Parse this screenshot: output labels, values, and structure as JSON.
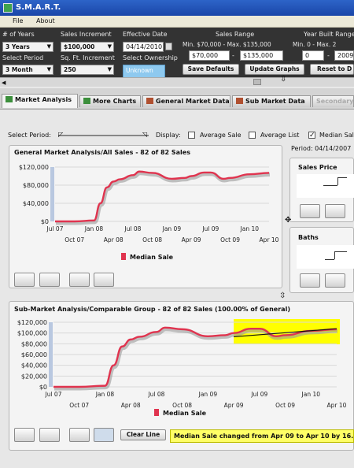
{
  "window": {
    "title": "S.M.A.R.T."
  },
  "menu": [
    "File",
    "About"
  ],
  "controls": {
    "years_label": "# of Years",
    "years_value": "3 Years",
    "period_label": "Select Period",
    "period_value": "3 Month",
    "sales_increment_label": "Sales Increment",
    "sales_increment_value": "$100,000",
    "sqft_increment_label": "Sq. Ft. Increment",
    "sqft_increment_value": "250",
    "effective_date_label": "Effective Date",
    "effective_date_value": "04/14/2010",
    "ownership_label": "Select Ownership",
    "ownership_value": "Unknown",
    "sales_range_label": "Sales Range",
    "sales_range_sub": "Min. $70,000 - Max. $135,000",
    "sales_min": "$70,000",
    "sales_max": "$135,000",
    "year_built_label": "Year Built Range",
    "year_built_sub": "Min. 0 - Max. 2",
    "year_min": "0",
    "year_max": "2009",
    "save_defaults": "Save Defaults",
    "update_graphs": "Update Graphs",
    "reset": "Reset to D"
  },
  "tabs": [
    "Market Analysis",
    "More Charts",
    "General Market Data",
    "Sub Market Data",
    "Secondary"
  ],
  "filters": {
    "select_period_label": "Select Period:",
    "display_label": "Display:",
    "average_sale": "Average Sale",
    "average_list": "Average List",
    "median_sale": "Median Sal"
  },
  "period_label": "Period: 04/14/2007",
  "side_panels": [
    {
      "title": "Sales Price"
    },
    {
      "title": "Baths"
    }
  ],
  "chart_panels": [
    {
      "title": "General Market Analysis/All Sales - 82 of 82 Sales"
    },
    {
      "title": "Sub-Market Analysis/Comparable Group - 82 of 82 Sales (100.00% of General)"
    }
  ],
  "clear_line": "Clear Line",
  "status_message": "Median Sale changed from Apr 09 to Apr 10 by 16.17%",
  "colors": {
    "series": "#e0344f",
    "highlight": "#ffff00",
    "band": "#333333"
  },
  "chart_data": [
    {
      "type": "line",
      "title": "General Market Analysis/All Sales - 82 of 82 Sales",
      "ylim": [
        0,
        120000
      ],
      "yticks": [
        "$120,000",
        "$80,000",
        "$40,000",
        "$0"
      ],
      "xticks_upper": [
        "Jul 07",
        "Jan 08",
        "Jul 08",
        "Jan 09",
        "Jul 09",
        "Jan 10"
      ],
      "xticks_lower": [
        "Oct 07",
        "Apr 08",
        "Oct 08",
        "Apr 09",
        "Oct 09",
        "Apr 10"
      ],
      "series": [
        {
          "name": "Median Sale",
          "x": [
            "Jul 07",
            "Oct 07",
            "Jan 08",
            "Feb 08",
            "Mar 08",
            "Apr 08",
            "May 08",
            "Jul 08",
            "Aug 08",
            "Oct 08",
            "Jan 09",
            "Mar 09",
            "Apr 09",
            "Jun 09",
            "Jul 09",
            "Sep 09",
            "Oct 09",
            "Jan 10",
            "Apr 10"
          ],
          "values": [
            0,
            0,
            2000,
            40000,
            75000,
            88000,
            93000,
            102000,
            110000,
            107000,
            94000,
            96000,
            100000,
            108000,
            108000,
            94000,
            96000,
            104000,
            107000
          ]
        }
      ]
    },
    {
      "type": "line",
      "title": "Sub-Market Analysis/Comparable Group - 82 of 82 Sales (100.00% of General)",
      "ylim": [
        0,
        120000
      ],
      "yticks": [
        "$120,000",
        "$100,000",
        "$80,000",
        "$60,000",
        "$40,000",
        "$20,000",
        "$0"
      ],
      "xticks_upper": [
        "Jul 07",
        "Jan 08",
        "Jul 08",
        "Jan 09",
        "Jul 09",
        "Jan 10"
      ],
      "xticks_lower": [
        "Oct 07",
        "Apr 08",
        "Oct 08",
        "Apr 09",
        "Oct 09",
        "Apr 10"
      ],
      "series": [
        {
          "name": "Median Sale",
          "x": [
            "Jul 07",
            "Oct 07",
            "Jan 08",
            "Feb 08",
            "Mar 08",
            "Apr 08",
            "May 08",
            "Jul 08",
            "Aug 08",
            "Oct 08",
            "Jan 09",
            "Mar 09",
            "Apr 09",
            "Jun 09",
            "Jul 09",
            "Sep 09",
            "Oct 09",
            "Jan 10",
            "Apr 10"
          ],
          "values": [
            0,
            0,
            2000,
            40000,
            75000,
            88000,
            93000,
            102000,
            110000,
            107000,
            94000,
            96000,
            100000,
            108000,
            108000,
            94000,
            96000,
            104000,
            107000
          ]
        }
      ],
      "trend": {
        "from": "Apr 09",
        "to": "Apr 10",
        "values": [
          93000,
          108000
        ]
      },
      "highlight_range": [
        "Apr 09",
        "Apr 10"
      ]
    }
  ]
}
